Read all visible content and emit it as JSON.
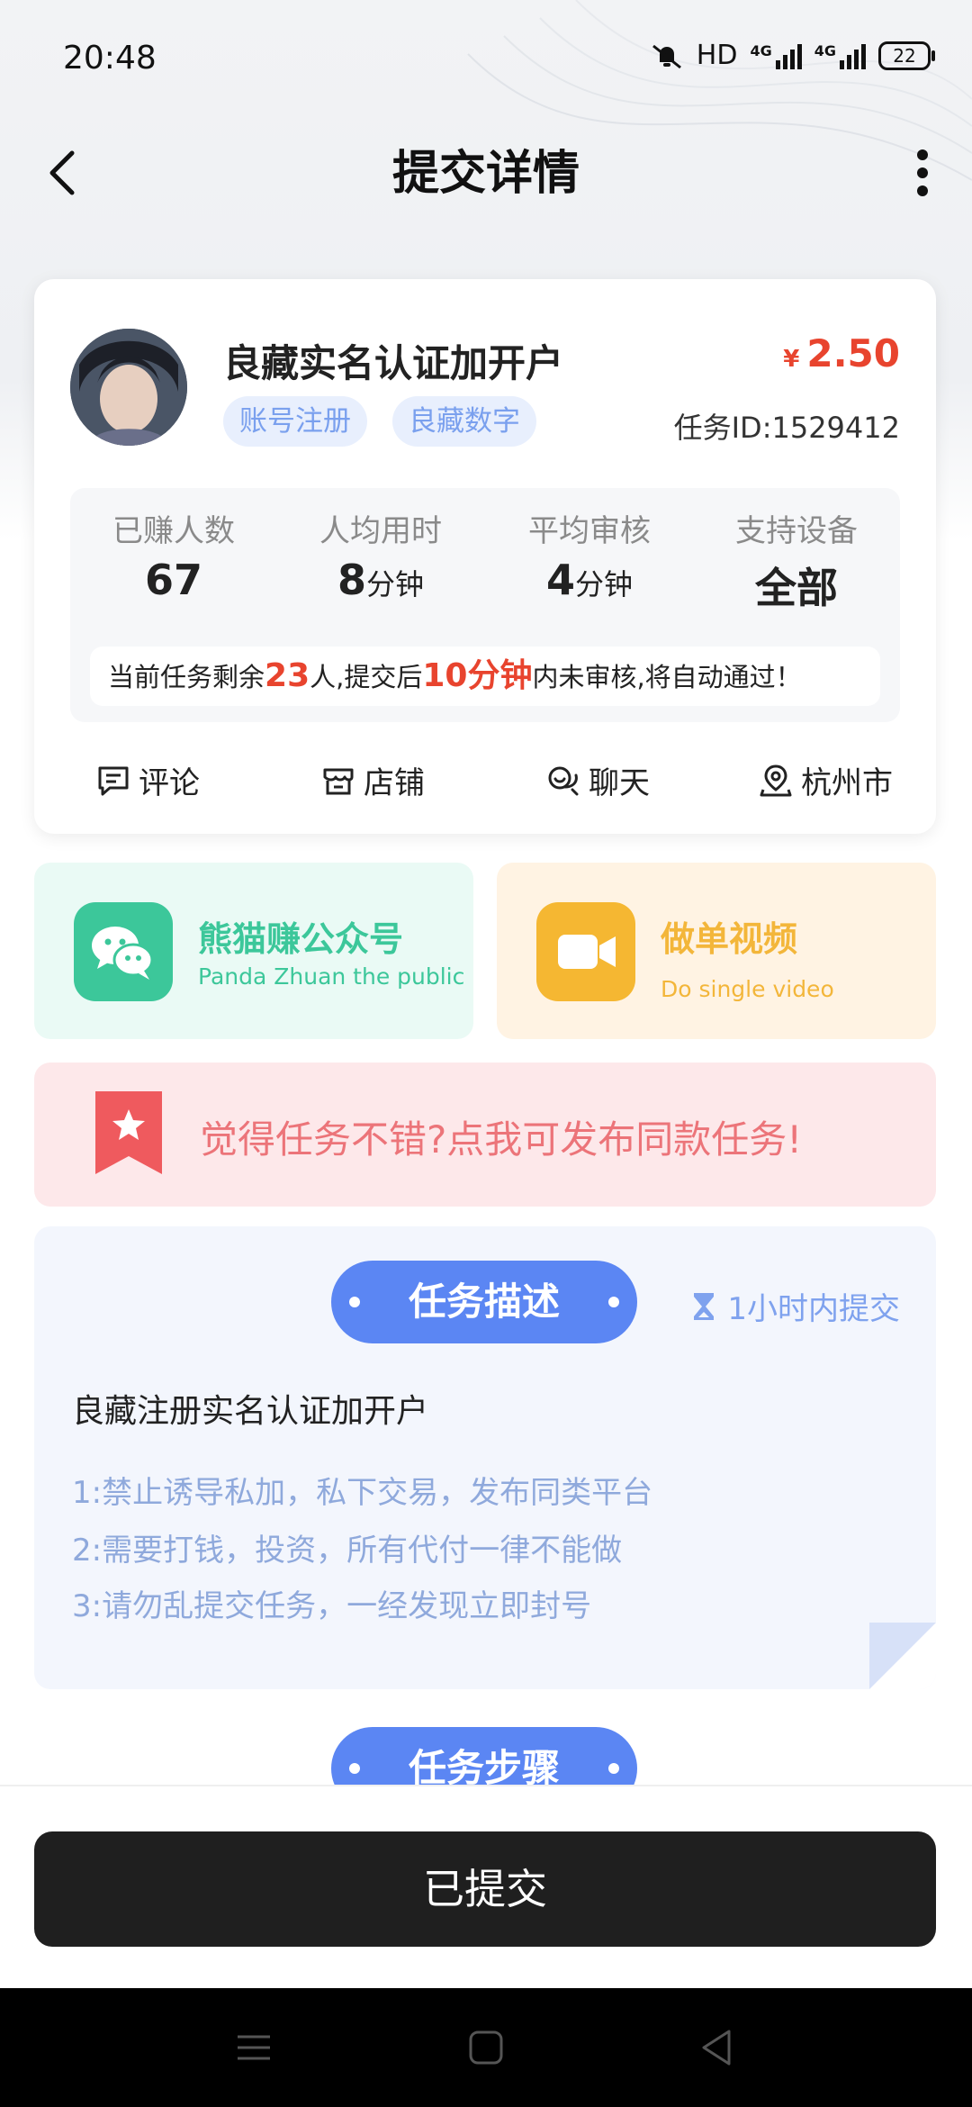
{
  "status_bar": {
    "time": "20:48",
    "network": "HD",
    "net1": "4G",
    "net2": "4G",
    "battery": "22"
  },
  "nav": {
    "title": "提交详情"
  },
  "task": {
    "title": "良藏实名认证加开户",
    "tags": [
      "账号注册",
      "良藏数字"
    ],
    "currency": "¥",
    "price": "2.50",
    "task_id": "任务ID:1529412",
    "stats": [
      {
        "label": "已赚人数",
        "value": "67",
        "unit": ""
      },
      {
        "label": "人均用时",
        "value": "8",
        "unit": "分钟"
      },
      {
        "label": "平均审核",
        "value": "4",
        "unit": "分钟"
      },
      {
        "label": "支持设备",
        "value": "全部",
        "unit": ""
      }
    ],
    "notice": {
      "p1": "当前任务剩余",
      "remain": "23",
      "p2": "人,提交后",
      "time": "10分钟",
      "p3": "内未审核,将自动通过！"
    },
    "actions": [
      {
        "label": "评论",
        "icon": "comment-icon"
      },
      {
        "label": "店铺",
        "icon": "store-icon"
      },
      {
        "label": "聊天",
        "icon": "chat-icon"
      },
      {
        "label": "杭州市",
        "icon": "location-icon"
      }
    ]
  },
  "promos": [
    {
      "title": "熊猫赚公众号",
      "subtitle": "Panda Zhuan the public",
      "color": "#3cc79a",
      "bg": "#eafaf5"
    },
    {
      "title": "做单视频",
      "subtitle": "Do single video",
      "color": "#f3b63a",
      "bg": "#fff3e3"
    }
  ],
  "publish": {
    "text": "觉得任务不错?点我可发布同款任务!"
  },
  "description": {
    "pill": "任务描述",
    "deadline": "1小时内提交",
    "heading": "良藏注册实名认证加开户",
    "rules": [
      "1:禁止诱导私加，私下交易，发布同类平台",
      "2:需要打钱，投资，所有代付一律不能做",
      "3:请勿乱提交任务，一经发现立即封号"
    ]
  },
  "steps": {
    "pill": "任务步骤"
  },
  "submit": {
    "label": "已提交"
  },
  "colors": {
    "accent": "#5b86f3",
    "price": "#e8442e",
    "button": "#1f1f1f"
  }
}
